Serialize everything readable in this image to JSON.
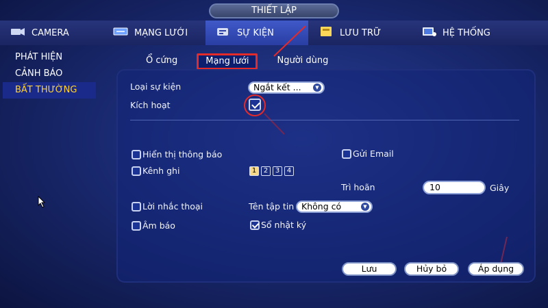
{
  "title": "THIẾT LẬP",
  "nav": {
    "tabs": [
      {
        "label": "CAMERA",
        "icon": "camera-icon"
      },
      {
        "label": "MẠNG LƯỚI",
        "icon": "network-icon"
      },
      {
        "label": "SỰ KIỆN",
        "icon": "event-icon"
      },
      {
        "label": "LƯU TRỮ",
        "icon": "storage-icon"
      },
      {
        "label": "HỆ THỐNG",
        "icon": "system-icon"
      }
    ],
    "active": "SỰ KIỆN"
  },
  "sidebar": {
    "items": [
      {
        "label": "PHÁT HIỆN"
      },
      {
        "label": "CẢNH BÁO"
      },
      {
        "label": "BẤT THƯỜNG"
      }
    ],
    "active": "BẤT THƯỜNG"
  },
  "subtabs": {
    "items": [
      {
        "label": "Ổ cứng"
      },
      {
        "label": "Mạng lưới"
      },
      {
        "label": "Người dùng"
      }
    ],
    "active": "Mạng lưới"
  },
  "form": {
    "event_type_label": "Loại sự kiện",
    "event_type_value": "Ngắt kết ...",
    "enable_label": "Kích hoạt",
    "enable_checked": true,
    "show_message_label": "Hiển thị thông báo",
    "send_email_label": "Gửi Email",
    "record_channel_label": "Kênh ghi",
    "channels": [
      "1",
      "2",
      "3",
      "4"
    ],
    "channel_1_on": true,
    "delay_label": "Trì hoãn",
    "delay_value": "10",
    "delay_unit": "Giây",
    "voice_prompt_label": "Lời nhắc thoại",
    "file_name_label": "Tên tập tin",
    "file_name_value": "Không có",
    "buzzer_label": "Âm báo",
    "log_label": "Sổ nhật ký",
    "log_checked": true
  },
  "buttons": {
    "save": "Lưu",
    "cancel": "Hủy bỏ",
    "apply": "Áp dụng"
  },
  "colors": {
    "highlight": "#e52a2a",
    "active_text": "#ffd23a",
    "background": "#1a2a72"
  }
}
